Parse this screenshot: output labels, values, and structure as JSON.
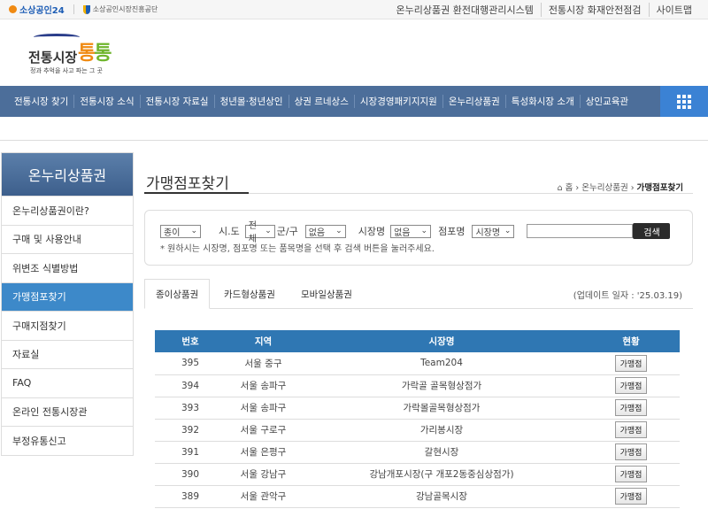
{
  "topbar": {
    "brand1": "소상공인24",
    "brand2": "소상공인시장진흥공단",
    "links": [
      "온누리상품권 환전대행관리시스템",
      "전통시장 화재안전점검",
      "사이트맵"
    ]
  },
  "logo": {
    "name1": "전통시장",
    "name2a": "통",
    "name2b": "통",
    "tagline": "정과 추억을 사고 파는 그 곳"
  },
  "nav": {
    "items": [
      "전통시장 찾기",
      "전통시장 소식",
      "전통시장 자료실",
      "청년몰·청년상인",
      "상권 르네상스",
      "시장경영패키지지원",
      "온누리상품권",
      "특성화시장 소개",
      "상인교육관"
    ],
    "menu_icon": "grid-menu-icon"
  },
  "sidebar": {
    "title": "온누리상품권",
    "items": [
      "온누리상품권이란?",
      "구매 및 사용안내",
      "위변조 식별방법",
      "가맹점포찾기",
      "구매지점찾기",
      "자료실",
      "FAQ",
      "온라인 전통시장관",
      "부정유통신고"
    ],
    "active": "가맹점포찾기"
  },
  "page": {
    "title": "가맹점포찾기",
    "breadcrumb": [
      "홈",
      "온누리상품권",
      "가맹점포찾기"
    ]
  },
  "search": {
    "type": "종이",
    "sido_label": "시.도",
    "sido": "전체",
    "gungu_label": "군/구",
    "gungu": "없음",
    "market_label": "시장명",
    "market": "없음",
    "store_label": "점포명",
    "store_type": "시장명",
    "keyword": "",
    "button": "검색",
    "hint": "* 원하시는 시장명, 점포명 또는 품목명을 선택 후 검색 버튼을 눌러주세요."
  },
  "tabs": {
    "items": [
      "종이상품권",
      "카드형상품권",
      "모바일상품권"
    ],
    "active": "종이상품권",
    "update": "(업데이트 일자 : '25.03.19)"
  },
  "table": {
    "headers": [
      "번호",
      "지역",
      "시장명",
      "현황"
    ],
    "button": "가맹점",
    "rows": [
      [
        "395",
        "서울 중구",
        "Team204"
      ],
      [
        "394",
        "서울 송파구",
        "가락골 골목형상점가"
      ],
      [
        "393",
        "서울 송파구",
        "가락몰골목형상점가"
      ],
      [
        "392",
        "서울 구로구",
        "가리봉시장"
      ],
      [
        "391",
        "서울 은평구",
        "갈현시장"
      ],
      [
        "390",
        "서울 강남구",
        "강남개포시장(구 개포2동중심상점가)"
      ],
      [
        "389",
        "서울 관악구",
        "강남골목시장"
      ]
    ]
  },
  "colors": {
    "nav": "#4c6e9a",
    "accent": "#3d89c9",
    "table_header": "#2f77b3"
  }
}
